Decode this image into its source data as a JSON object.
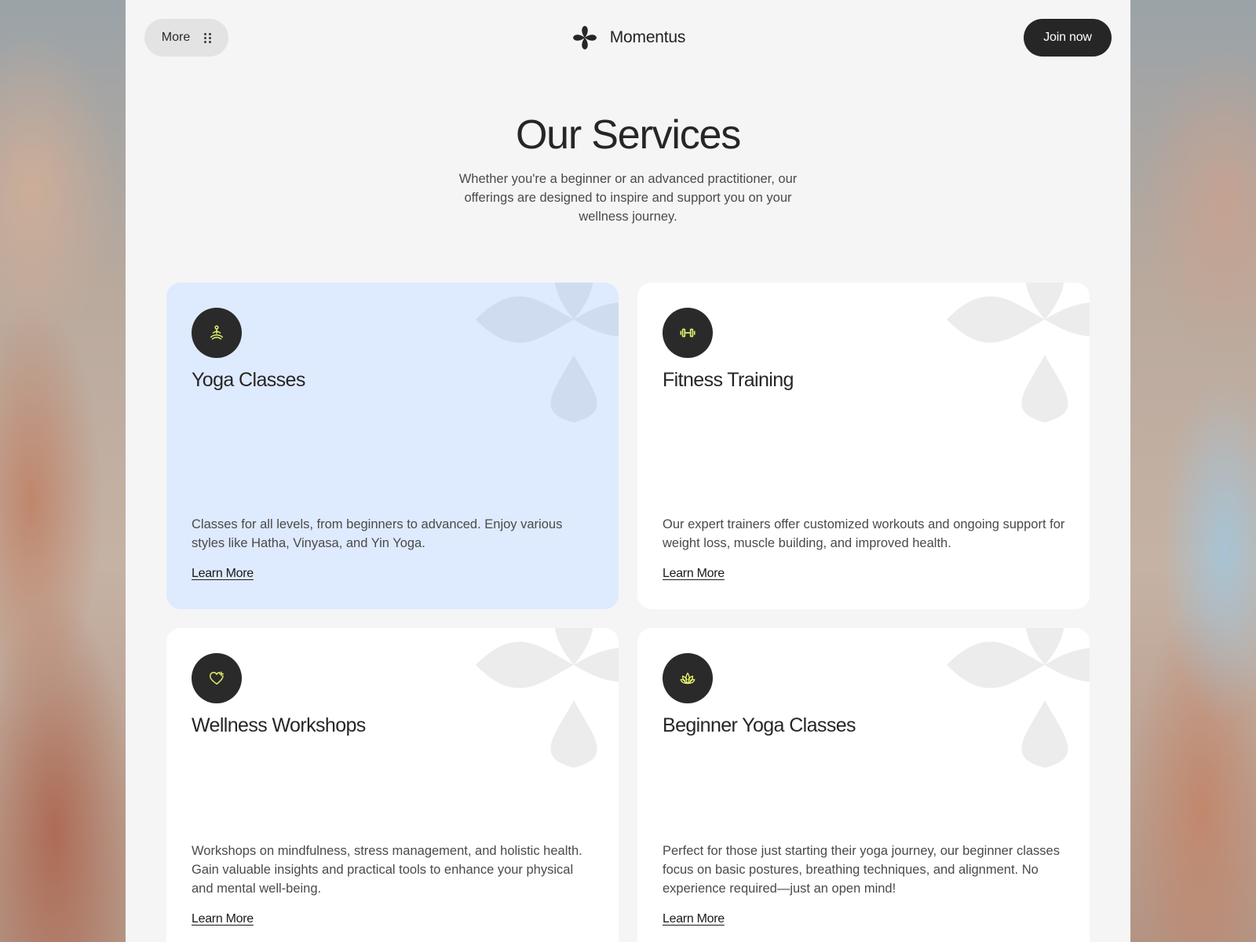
{
  "colors": {
    "page_bg": "#f5f5f6",
    "dark": "#262626",
    "accent_icon": "#e4f06a",
    "card_highlight": "#deeafd",
    "card_default": "#ffffff"
  },
  "header": {
    "more_label": "More",
    "more_icon": "grid-dots-icon",
    "brand_name": "Momentus",
    "brand_icon": "four-petal-flower-logo",
    "join_label": "Join now"
  },
  "hero": {
    "title": "Our Services",
    "subtitle": "Whether you're a beginner or an advanced practitioner, our offerings are designed to inspire and support you on your wellness journey."
  },
  "services": [
    {
      "title": "Yoga Classes",
      "description": "Classes for all levels, from beginners to advanced. Enjoy various styles like Hatha, Vinyasa, and Yin Yoga.",
      "link": "Learn More",
      "icon": "meditation-icon",
      "highlighted": true
    },
    {
      "title": "Fitness Training",
      "description": "Our expert trainers offer customized workouts and ongoing support for weight loss, muscle building, and improved health.",
      "link": "Learn More",
      "icon": "dumbbell-icon",
      "highlighted": false
    },
    {
      "title": "Wellness Workshops",
      "description": "Workshops on mindfulness, stress management, and holistic health. Gain valuable insights and practical tools to enhance your physical and mental well-being.",
      "link": "Learn More",
      "icon": "heart-plus-icon",
      "highlighted": false
    },
    {
      "title": "Beginner Yoga Classes",
      "description": "Perfect for those just starting their yoga journey, our beginner classes focus on basic postures, breathing techniques, and alignment. No experience required—just an open mind!",
      "link": "Learn More",
      "icon": "lotus-icon",
      "highlighted": false
    }
  ]
}
